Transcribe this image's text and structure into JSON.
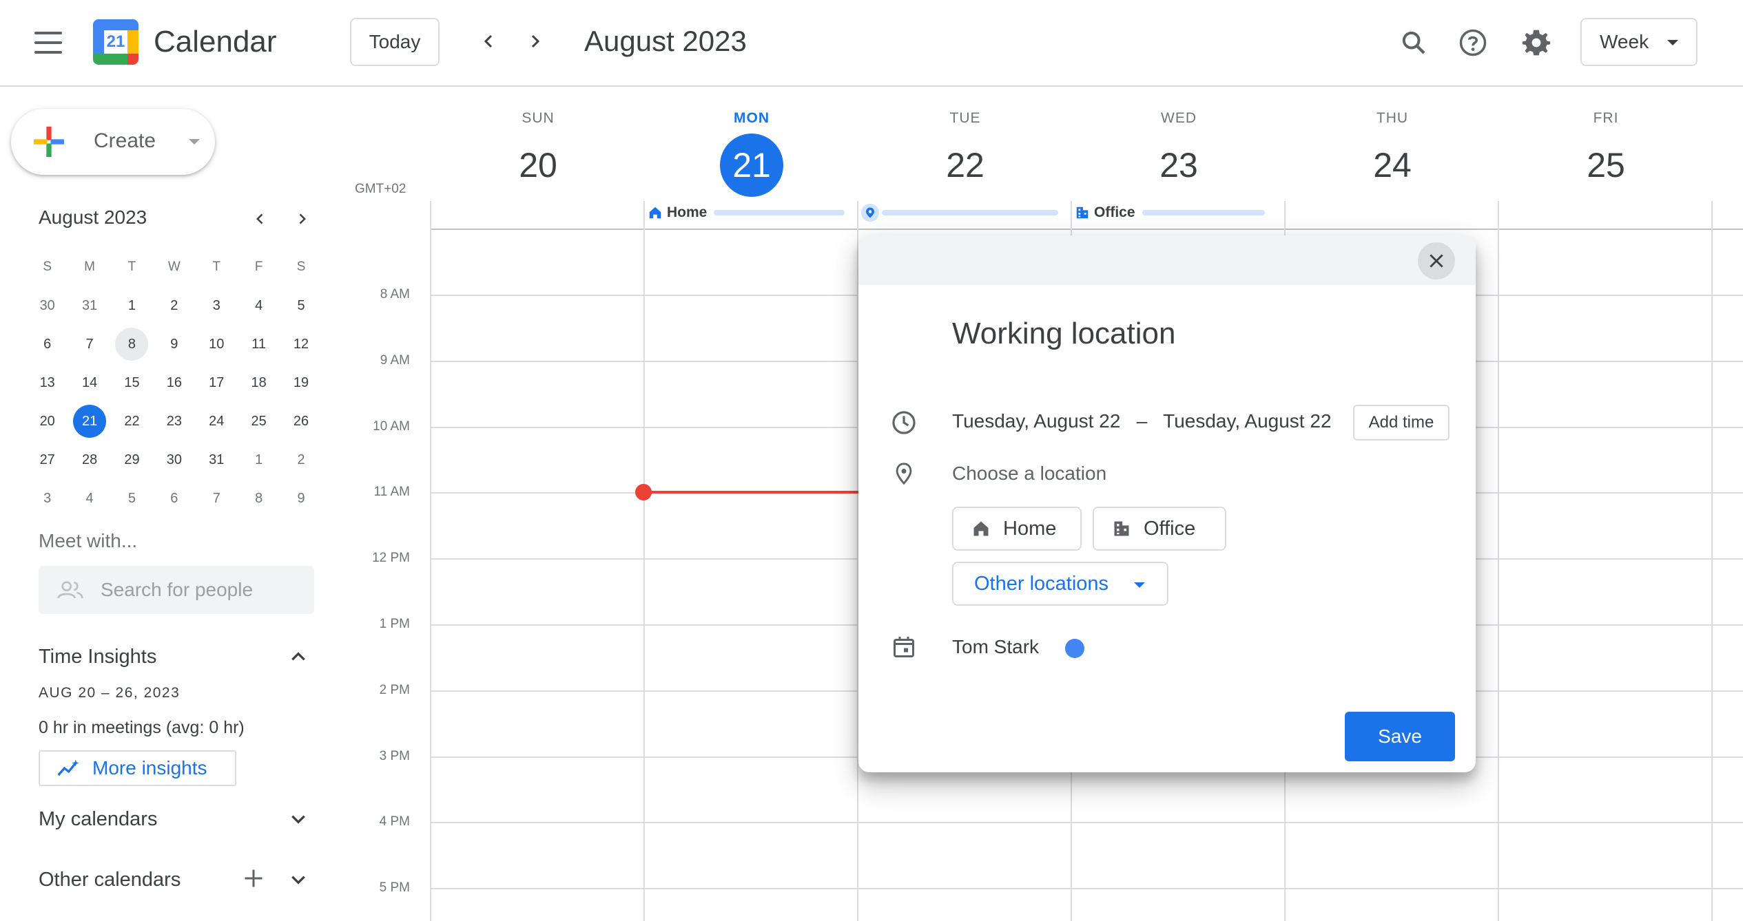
{
  "header": {
    "app_title": "Calendar",
    "logo_day": "21",
    "today_label": "Today",
    "period_title": "August 2023",
    "view_label": "Week"
  },
  "sidebar": {
    "create_label": "Create",
    "mini_calendar": {
      "title": "August 2023",
      "weekday_heads": [
        "S",
        "M",
        "T",
        "W",
        "T",
        "F",
        "S"
      ],
      "weeks": [
        [
          "30",
          "31",
          "1",
          "2",
          "3",
          "4",
          "5"
        ],
        [
          "6",
          "7",
          "8",
          "9",
          "10",
          "11",
          "12"
        ],
        [
          "13",
          "14",
          "15",
          "16",
          "17",
          "18",
          "19"
        ],
        [
          "20",
          "21",
          "22",
          "23",
          "24",
          "25",
          "26"
        ],
        [
          "27",
          "28",
          "29",
          "30",
          "31",
          "1",
          "2"
        ],
        [
          "3",
          "4",
          "5",
          "6",
          "7",
          "8",
          "9"
        ]
      ],
      "selected_day": "21",
      "highlighted_day": "8"
    },
    "meet_with_label": "Meet with...",
    "search_people_placeholder": "Search for people",
    "time_insights": {
      "title": "Time Insights",
      "range": "AUG 20 – 26, 2023",
      "meetings": "0 hr in meetings (avg: 0 hr)",
      "more_insights_label": "More insights"
    },
    "my_calendars_label": "My calendars",
    "other_calendars_label": "Other calendars"
  },
  "week": {
    "timezone": "GMT+02",
    "days": [
      {
        "name": "SUN",
        "num": "20"
      },
      {
        "name": "MON",
        "num": "21"
      },
      {
        "name": "TUE",
        "num": "22"
      },
      {
        "name": "WED",
        "num": "23"
      },
      {
        "name": "THU",
        "num": "24"
      },
      {
        "name": "FRI",
        "num": "25"
      }
    ],
    "hours": [
      "8 AM",
      "9 AM",
      "10 AM",
      "11 AM",
      "12 PM",
      "1 PM",
      "2 PM",
      "3 PM",
      "4 PM",
      "5 PM"
    ],
    "working_locations": {
      "mon": "Home",
      "wed": "Office"
    }
  },
  "dialog": {
    "title": "Working location",
    "dates": "Tuesday, August 22   –   Tuesday, August 22",
    "add_time_label": "Add time",
    "choose_location": "Choose a location",
    "home_label": "Home",
    "office_label": "Office",
    "other_locations_label": "Other locations",
    "calendar_owner": "Tom Stark",
    "calendar_color": "#4285f4",
    "save_label": "Save"
  },
  "colors": {
    "accent": "#1a73e8",
    "now_line": "#ea4335"
  }
}
